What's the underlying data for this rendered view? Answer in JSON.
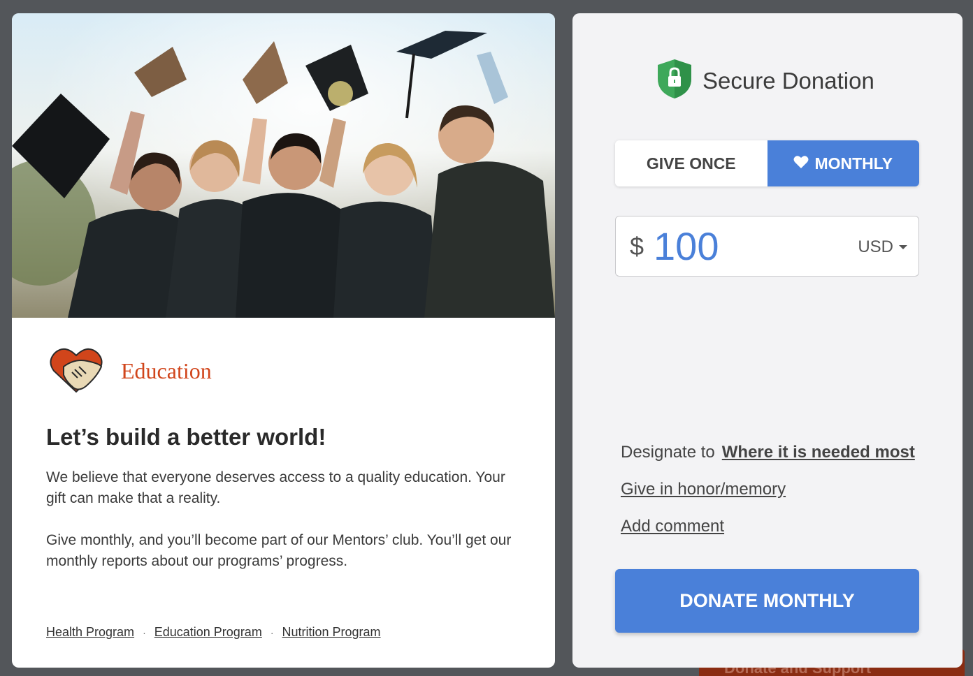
{
  "background": {
    "footer_cta": "Donate and Support"
  },
  "program": {
    "icon": "heart-handshake-icon",
    "name": "Education",
    "headline": "Let’s build a better world!",
    "paragraph_1": "We believe that everyone deserves access to a quality education. Your gift can make that a reality.",
    "paragraph_2": "Give monthly, and you’ll become part of our Mentors’ club. You’ll get our monthly reports about our programs’ progress.",
    "links": [
      "Health Program",
      "Education Program",
      "Nutrition Program"
    ],
    "link_separator": "·"
  },
  "donation": {
    "icon": "shield-lock-icon",
    "title": "Secure Donation",
    "frequency": {
      "once_label": "GIVE ONCE",
      "monthly_label": "MONTHLY",
      "selected": "monthly"
    },
    "currency_symbol": "$",
    "amount": "100",
    "currency": "USD",
    "designate_label": "Designate to",
    "designate_value": "Where it is needed most",
    "honor_label": "Give in honor/memory",
    "comment_label": "Add comment",
    "submit_label": "DONATE MONTHLY"
  },
  "colors": {
    "accent": "#4a80d9",
    "program": "#d1451b",
    "shield": "#3ea85a"
  }
}
